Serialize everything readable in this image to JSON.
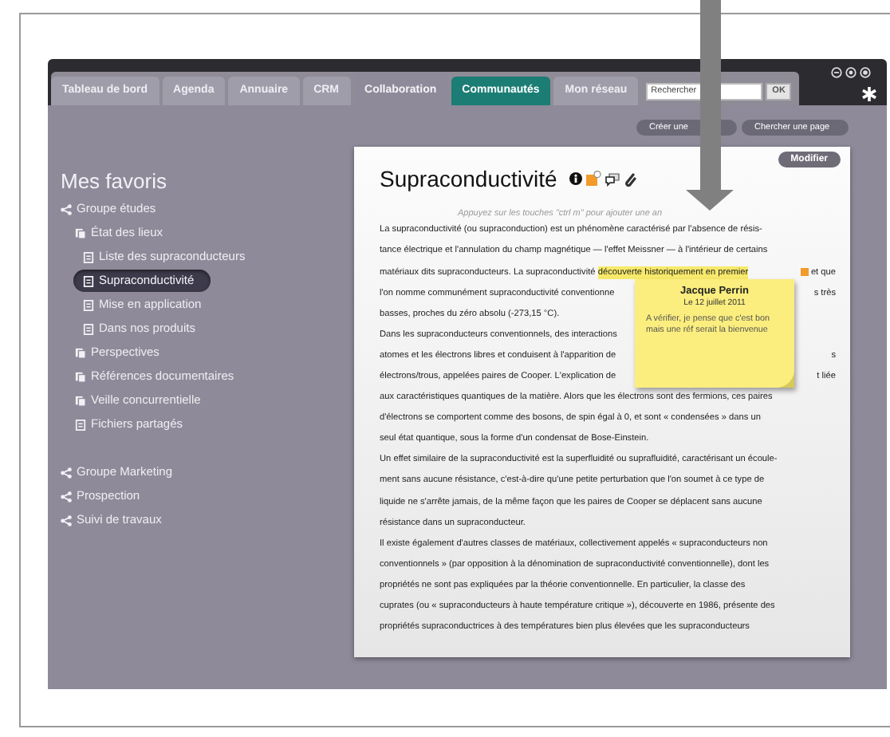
{
  "tabs": [
    {
      "label": "Tableau de bord",
      "selected": false,
      "kind": "plain"
    },
    {
      "label": "Agenda",
      "selected": false,
      "kind": "plain"
    },
    {
      "label": "Annuaire",
      "selected": false,
      "kind": "plain"
    },
    {
      "label": "CRM",
      "selected": false,
      "kind": "plain"
    },
    {
      "label": "Collaboration",
      "selected": true,
      "kind": "plain"
    },
    {
      "label": "Communautés",
      "selected": false,
      "kind": "accent"
    },
    {
      "label": "Mon réseau",
      "selected": false,
      "kind": "plain"
    }
  ],
  "search": {
    "placeholder": "Rechercher",
    "button": "OK"
  },
  "page_actions": [
    "Créer une",
    "Chercher une page"
  ],
  "sidebar": {
    "title": "Mes favoris",
    "items": [
      {
        "label": "Groupe études",
        "kind": "group",
        "selected": false,
        "children": [
          {
            "label": "État des lieux",
            "kind": "folder",
            "selected": false,
            "children": [
              {
                "label": "Liste des supraconducteurs",
                "kind": "page",
                "selected": false
              },
              {
                "label": "Supraconductivité",
                "kind": "page",
                "selected": true
              },
              {
                "label": "Mise en application",
                "kind": "page",
                "selected": false
              },
              {
                "label": "Dans nos produits",
                "kind": "page",
                "selected": false
              }
            ]
          },
          {
            "label": "Perspectives",
            "kind": "folder",
            "selected": false
          },
          {
            "label": "Références documentaires",
            "kind": "folder",
            "selected": false
          },
          {
            "label": "Veille concurrentielle",
            "kind": "folder",
            "selected": false
          },
          {
            "label": "Fichiers partagés",
            "kind": "page",
            "selected": false
          }
        ]
      },
      {
        "label": "Groupe Marketing",
        "kind": "group",
        "selected": false
      },
      {
        "label": "Prospection",
        "kind": "group",
        "selected": false
      },
      {
        "label": "Suivi de travaux",
        "kind": "group",
        "selected": false
      }
    ]
  },
  "article": {
    "edit_button": "Modifier",
    "title": "Supraconductivité",
    "hint": "Appuyez sur les touches \"ctrl m\" pour ajouter une an",
    "lines": [
      {
        "text": "La supraconductivité (ou supraconduction) est un phénomène caractérisé par l'absence de résis-"
      },
      {
        "text": "tance électrique et l'annulation du champ magnétique — l'effet Meissner — à l'intérieur de certains"
      },
      {
        "text": "matériaux dits supraconducteurs. La supraconductivité ",
        "highlight": "découverte historiquement en premier",
        "note_anchor": true,
        "right": "et que"
      },
      {
        "text": "l'on nomme communément supraconductivité conventionne",
        "right": "s très"
      },
      {
        "text": "basses, proches du zéro absolu (-273,15 °C)."
      },
      {
        "text": "Dans les supraconducteurs conventionnels, des interactions"
      },
      {
        "text": "atomes et les électrons libres et conduisent à l'apparition de",
        "right": "s"
      },
      {
        "text": "électrons/trous, appelées paires de Cooper. L'explication de",
        "right": "t liée"
      },
      {
        "text": "aux caractéristiques quantiques de la matière. Alors que les électrons sont des fermions, ces paires"
      },
      {
        "text": "d'électrons se comportent comme des bosons, de spin égal à 0, et sont « condensées » dans un"
      },
      {
        "text": "seul état quantique, sous la forme d'un condensat de Bose-Einstein."
      },
      {
        "text": "Un effet similaire de la supraconductivité est la superfluidité ou suprafluidité, caractérisant un écoule-"
      },
      {
        "text": "ment sans aucune résistance, c'est-à-dire qu'une petite perturbation que l'on soumet à ce type de"
      },
      {
        "text": "liquide ne s'arrête jamais, de la même façon que les paires de Cooper se déplacent sans aucune"
      },
      {
        "text": "résistance dans un supraconducteur."
      },
      {
        "text": "Il existe également d'autres classes de matériaux, collectivement appelés « supraconducteurs non"
      },
      {
        "text": "conventionnels » (par opposition à la dénomination de supraconductivité conventionnelle), dont les"
      },
      {
        "text": "propriétés ne sont pas expliquées par la théorie conventionnelle. En particulier, la classe des"
      },
      {
        "text": "cuprates (ou « supraconducteurs à haute température critique »), découverte en 1986, présente des"
      },
      {
        "text": "propriétés supraconductrices à des températures bien plus élevées que les supraconducteurs"
      }
    ],
    "note": {
      "author": "Jacque Perrin",
      "date": "Le 12 juillet 2011",
      "text": "A vérifier, je pense que c'est bon mais une réf serait la bienvenue"
    }
  }
}
